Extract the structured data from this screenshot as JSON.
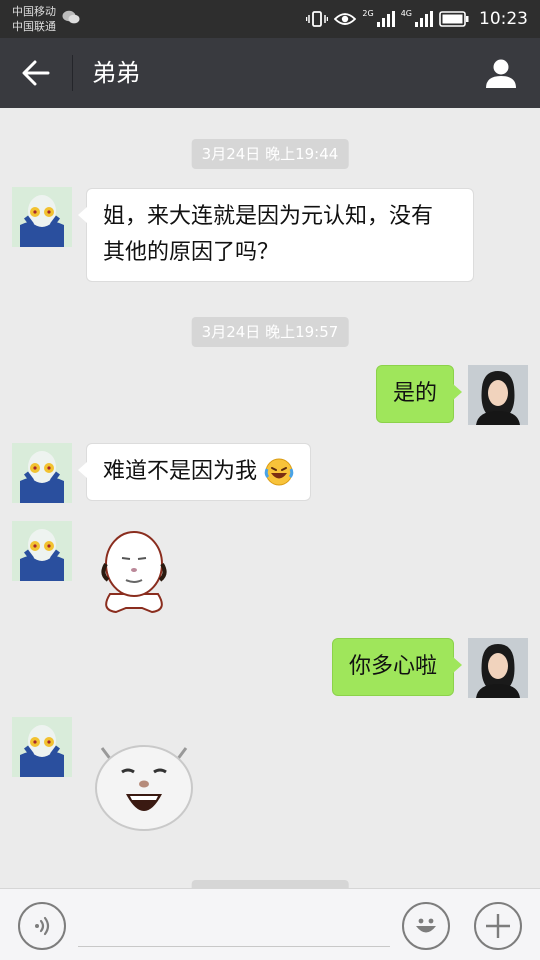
{
  "status_bar": {
    "carrier_1": "中国移动",
    "carrier_2": "中国联通",
    "network_1": "2G",
    "network_2": "4G",
    "time": "10:23",
    "icons": [
      "wechat-icon",
      "vibrate-icon",
      "eye-icon",
      "signal-icon",
      "battery-icon"
    ]
  },
  "header": {
    "title": "弟弟",
    "back_icon": "arrow-left-icon",
    "profile_icon": "person-icon",
    "background": "#393a3f"
  },
  "messages": [
    {
      "type": "timestamp",
      "text": "3月24日 晚上19:44"
    },
    {
      "type": "text",
      "side": "left",
      "sender": "弟弟",
      "lines": [
        "姐，来大连就是因为元认知，没有",
        "其他的原因了吗？"
      ]
    },
    {
      "type": "timestamp",
      "text": "3月24日 晚上19:57"
    },
    {
      "type": "text",
      "side": "right",
      "sender": "me",
      "text": "是的"
    },
    {
      "type": "text",
      "side": "left",
      "sender": "弟弟",
      "text": "难道不是因为我",
      "emoji": "laughing-crying-emoji"
    },
    {
      "type": "sticker",
      "side": "left",
      "sender": "弟弟",
      "sticker": "panda-face-sticker"
    },
    {
      "type": "text",
      "side": "right",
      "sender": "me",
      "text": "你多心啦"
    },
    {
      "type": "sticker",
      "side": "left",
      "sender": "弟弟",
      "sticker": "laughing-pig-sticker"
    }
  ],
  "input_bar": {
    "value": "",
    "voice_icon": "voice-icon",
    "emoji_icon": "smiley-icon",
    "plus_icon": "plus-icon"
  },
  "colors": {
    "bubble_sent": "#9fe65b",
    "bubble_received": "#ffffff",
    "chat_background": "#ebebeb",
    "timestamp_pill": "#d6d6d6"
  }
}
